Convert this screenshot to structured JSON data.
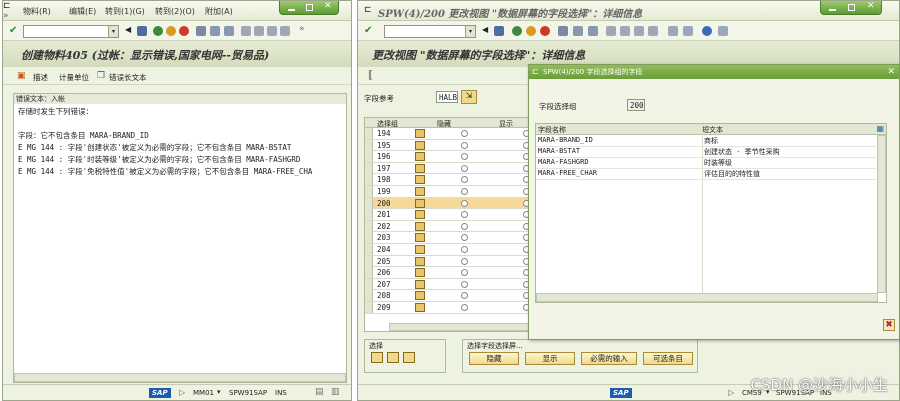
{
  "left": {
    "menu": [
      "物料(R)",
      "编辑(E)",
      "转到(1)(G)",
      "转到(2)(O)",
      "附加(A)"
    ],
    "title": "创建物料405 (过帐：显示错误,国家电网--贸易品)",
    "app_toolbar": [
      "描述",
      "计量单位",
      "错误长文本"
    ],
    "panel_header": "错误文本：入帐",
    "intro": "存储时发生下列错误：",
    "messages": [
      "字段：它不包含条目 MARA-BRAND_ID",
      "E MG 144 : 字段'创建状态'被定义为必需的字段；它不包含条目 MARA-BSTAT",
      "E MG 144 : 字段'时装等级'被定义为必需的字段；它不包含条目 MARA-FASHGRD",
      "E MG 144 : 字段'免税特性值'被定义为必需的字段；它不包含条目 MARA-FREE_CHA"
    ],
    "status": {
      "sap": "SAP",
      "client": "MM01",
      "server": "SPW91SAP",
      "mode": "INS"
    }
  },
  "right": {
    "title_bar": "SPW(4)/200 更改视图 \"数据屏幕的字段选择\"：详细信息",
    "title": "更改视图 \"数据屏幕的字段选择\"：详细信息",
    "ref_label": "字段参考",
    "ref_value": "HALB",
    "grid_headers": [
      "选择组",
      "隐藏",
      "显示"
    ],
    "grid_rows": [
      "194",
      "195",
      "196",
      "197",
      "198",
      "199",
      "200",
      "201",
      "202",
      "203",
      "204",
      "205",
      "206",
      "207",
      "208",
      "209"
    ],
    "selected_row": "200",
    "bottom": {
      "sel_label": "选择",
      "sel_field_label": "选择字段选择屏...",
      "buttons": [
        "隐藏",
        "显示",
        "必需的输入",
        "可选条目"
      ]
    },
    "status": {
      "sap": "SAP",
      "client": "CMS9",
      "server": "SPW91SAP",
      "mode": "INS"
    }
  },
  "popup": {
    "title": "SPW(4)/200 字段选择组的字段",
    "group_label": "字段选择组",
    "group_value": "200",
    "col_headers": [
      "字段名称",
      "短文本"
    ],
    "rows": [
      {
        "name": "MARA-BRAND_ID",
        "text": "商标"
      },
      {
        "name": "MARA-BSTAT",
        "text": "创建状态 - 季节性采购"
      },
      {
        "name": "MARA-FASHGRD",
        "text": "时装等级"
      },
      {
        "name": "MARA-FREE_CHAR",
        "text": "评估目的的特性值"
      }
    ]
  },
  "watermark": "CSDN @沙海小小生",
  "colors": {
    "sap_blue": "#1a5db0",
    "selection_row": "#f6d99a",
    "window_green": "#6a9c38"
  }
}
